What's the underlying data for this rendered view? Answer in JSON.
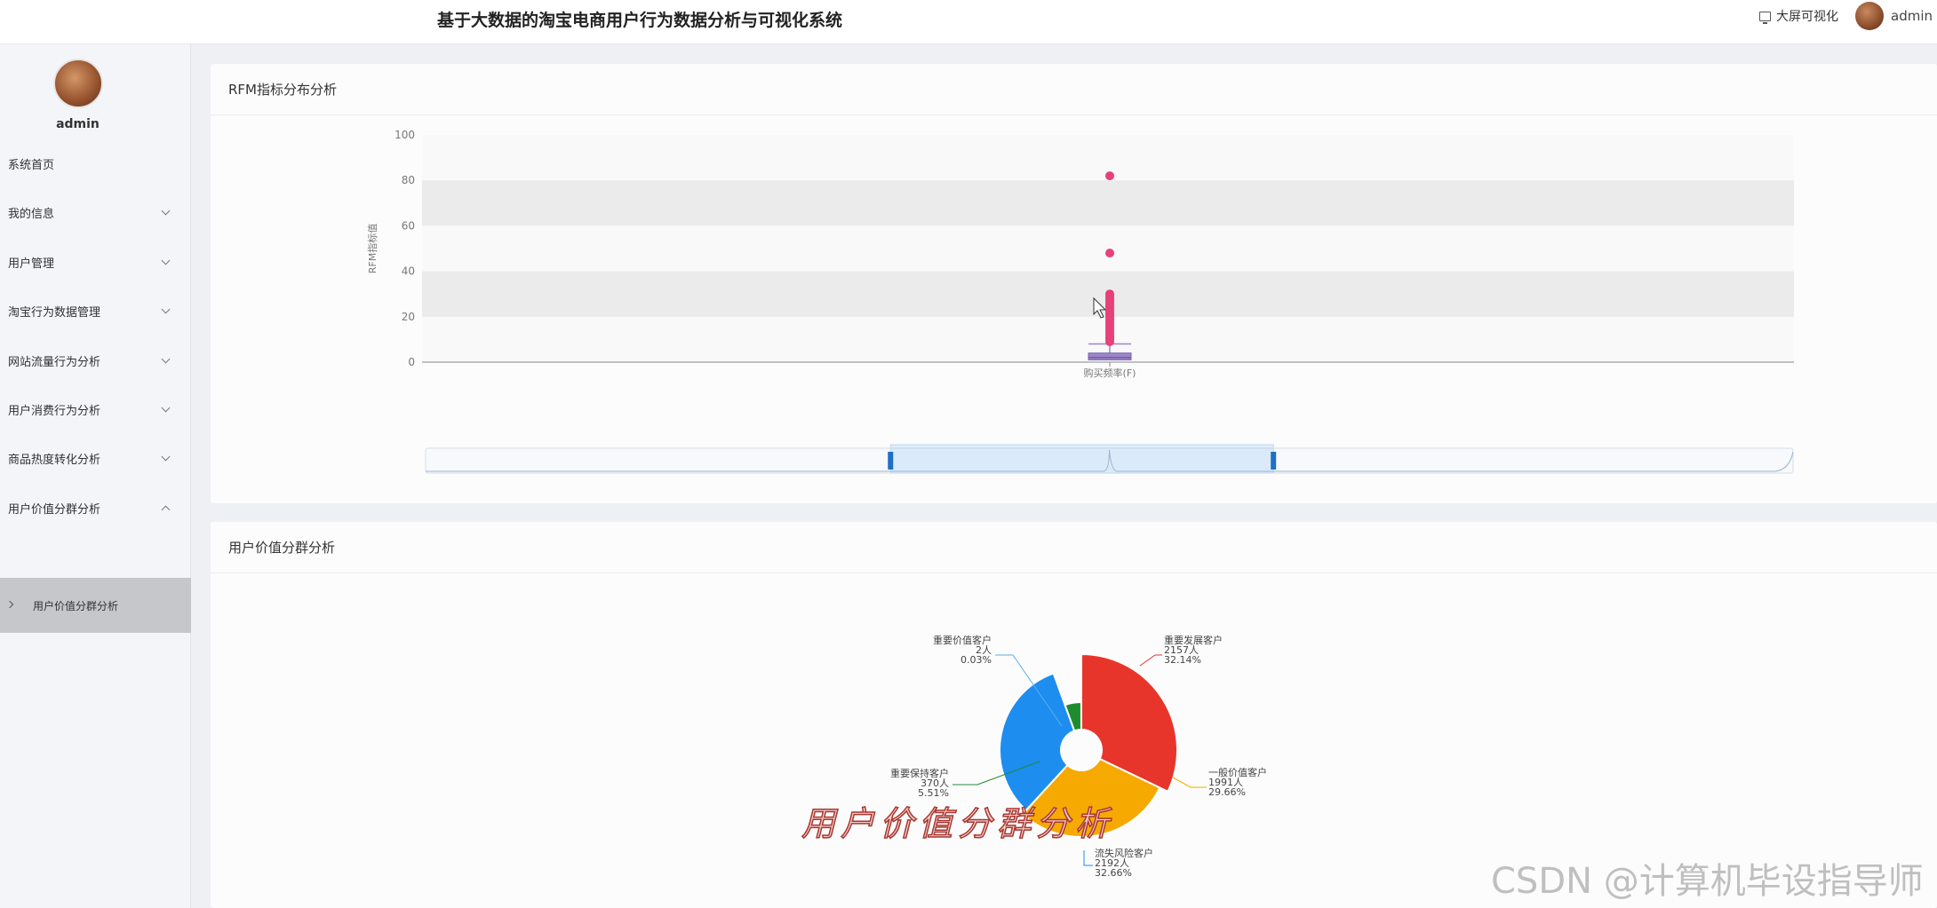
{
  "header": {
    "title": "基于大数据的淘宝电商用户行为数据分析与可视化系统",
    "bigscreen_label": "大屏可视化",
    "username": "admin"
  },
  "sidebar": {
    "username": "admin",
    "items": [
      {
        "label": "系统首页",
        "expandable": false
      },
      {
        "label": "我的信息",
        "expandable": true
      },
      {
        "label": "用户管理",
        "expandable": true
      },
      {
        "label": "淘宝行为数据管理",
        "expandable": true
      },
      {
        "label": "网站流量行为分析",
        "expandable": true
      },
      {
        "label": "用户消费行为分析",
        "expandable": true
      },
      {
        "label": "商品热度转化分析",
        "expandable": true
      },
      {
        "label": "用户价值分群分析",
        "expandable": true,
        "expanded": true
      }
    ],
    "active_subitem": "用户价值分群分析"
  },
  "rfm_panel": {
    "title": "RFM指标分布分析"
  },
  "segment_panel": {
    "title": "用户价值分群分析"
  },
  "chart_data": [
    {
      "type": "box",
      "ylabel": "RFM指标值",
      "ylim": [
        0,
        100
      ],
      "yticks": [
        0,
        20,
        40,
        60,
        80,
        100
      ],
      "categories": [
        "购买频率(F)"
      ],
      "box": {
        "min": 1,
        "q1": 1,
        "median": 2,
        "q3": 4,
        "max": 8
      },
      "outliers": [
        9,
        10,
        11,
        12,
        13,
        14,
        15,
        16,
        17,
        18,
        19,
        20,
        21,
        22,
        23,
        24,
        25,
        26,
        27,
        28,
        29,
        30,
        48,
        82
      ],
      "colors": {
        "box": "#9b86c8",
        "outlier": "#e84078",
        "band": "#ebebeb"
      },
      "grid": true,
      "datazoom": {
        "start": 0.34,
        "end": 0.62
      }
    },
    {
      "type": "pie",
      "rose": true,
      "slices": [
        {
          "name": "重要发展客户",
          "count_label": "2157人",
          "pct_label": "32.14%",
          "value": 2157,
          "color": "#e8352b"
        },
        {
          "name": "一般价值客户",
          "count_label": "1991人",
          "pct_label": "29.66%",
          "value": 1991,
          "color": "#f6a900"
        },
        {
          "name": "流失风险客户",
          "count_label": "2192人",
          "pct_label": "32.66%",
          "value": 2192,
          "color": "#1d8df0"
        },
        {
          "name": "重要保持客户",
          "count_label": "370人",
          "pct_label": "5.51%",
          "value": 370,
          "color": "#1e8c2e"
        },
        {
          "name": "重要价值客户",
          "count_label": "2人",
          "pct_label": "0.03%",
          "value": 2,
          "color": "#5ab1e8"
        }
      ]
    }
  ],
  "overlay_caption": "用户价值分群分析",
  "watermark": "CSDN @计算机毕设指导师"
}
